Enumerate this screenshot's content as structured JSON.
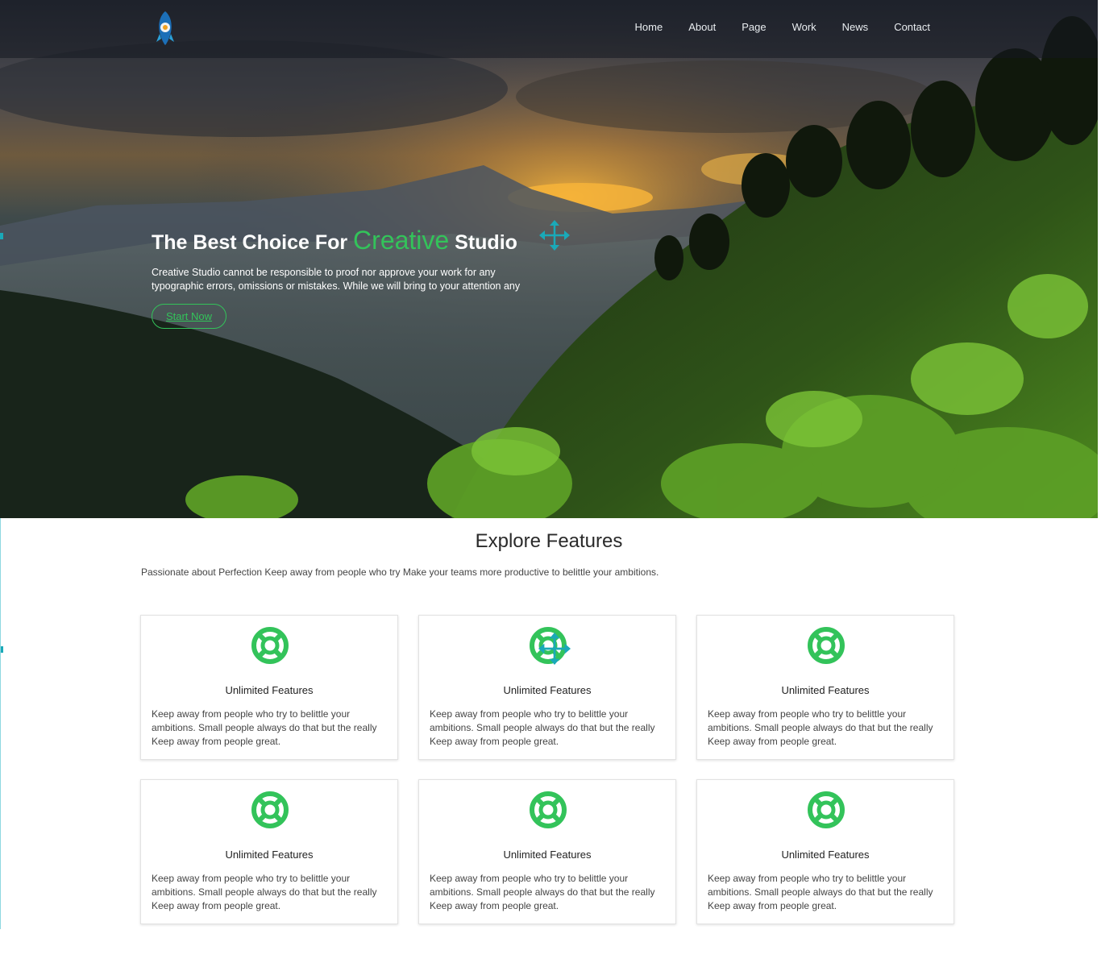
{
  "nav": {
    "logo": "logo-icon",
    "items": [
      {
        "label": "Home"
      },
      {
        "label": "About"
      },
      {
        "label": "Page"
      },
      {
        "label": "Work"
      },
      {
        "label": "News"
      },
      {
        "label": "Contact"
      }
    ]
  },
  "hero": {
    "title_before": "The Best Choice For",
    "title_accent": "Creative",
    "title_after": "Studio",
    "text": "Creative Studio cannot be responsible to proof nor approve your work for any typographic errors, omissions or mistakes. While we will bring to your attention any",
    "button_label": "Start Now"
  },
  "features": {
    "title": "Explore Features",
    "subtitle": "Passionate about Perfection Keep away from people who try Make your teams more productive to belittle your ambitions.",
    "cards": [
      {
        "icon": "life-ring-icon",
        "title": "Unlimited Features",
        "text": "Keep away from people who try to belittle your ambitions. Small people always do that but the really Keep away from people great."
      },
      {
        "icon": "life-ring-icon",
        "title": "Unlimited Features",
        "text": "Keep away from people who try to belittle your ambitions. Small people always do that but the really Keep away from people great."
      },
      {
        "icon": "life-ring-icon",
        "title": "Unlimited Features",
        "text": "Keep away from people who try to belittle your ambitions. Small people always do that but the really Keep away from people great."
      },
      {
        "icon": "life-ring-icon",
        "title": "Unlimited Features",
        "text": "Keep away from people who try to belittle your ambitions. Small people always do that but the really Keep away from people great."
      },
      {
        "icon": "life-ring-icon",
        "title": "Unlimited Features",
        "text": "Keep away from people who try to belittle your ambitions. Small people always do that but the really Keep away from people great."
      },
      {
        "icon": "life-ring-icon",
        "title": "Unlimited Features",
        "text": "Keep away from people who try to belittle your ambitions. Small people always do that but the really Keep away from people great."
      }
    ]
  },
  "colors": {
    "accent": "#33c35a",
    "handle": "#1aa9b8",
    "nav_text": "#e9edf0"
  }
}
